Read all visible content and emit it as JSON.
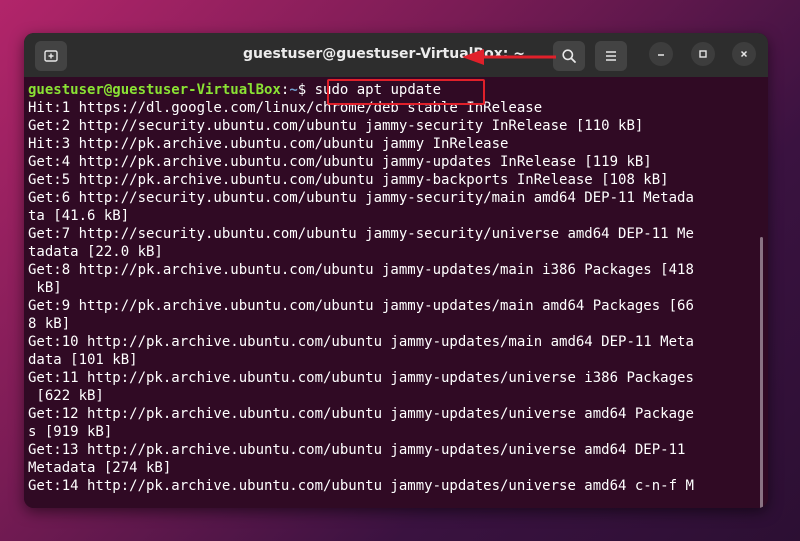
{
  "window": {
    "title": "guestuser@guestuser-VirtualBox: ~",
    "buttons": {
      "new_tab_icon": "new-tab-icon",
      "search_icon": "search-icon",
      "menu_icon": "hamburger-menu-icon",
      "minimize_icon": "minimize-icon",
      "maximize_icon": "maximize-icon",
      "close_icon": "close-icon"
    }
  },
  "prompt": {
    "user_host": "guestuser@guestuser-VirtualBox",
    "separator": ":",
    "directory": "~",
    "symbol": "$ ",
    "command": "sudo apt update"
  },
  "output": [
    "Hit:1 https://dl.google.com/linux/chrome/deb stable InRelease",
    "Get:2 http://security.ubuntu.com/ubuntu jammy-security InRelease [110 kB]",
    "Hit:3 http://pk.archive.ubuntu.com/ubuntu jammy InRelease",
    "Get:4 http://pk.archive.ubuntu.com/ubuntu jammy-updates InRelease [119 kB]",
    "Get:5 http://pk.archive.ubuntu.com/ubuntu jammy-backports InRelease [108 kB]",
    "Get:6 http://security.ubuntu.com/ubuntu jammy-security/main amd64 DEP-11 Metada",
    "ta [41.6 kB]",
    "Get:7 http://security.ubuntu.com/ubuntu jammy-security/universe amd64 DEP-11 Me",
    "tadata [22.0 kB]",
    "Get:8 http://pk.archive.ubuntu.com/ubuntu jammy-updates/main i386 Packages [418",
    " kB]",
    "Get:9 http://pk.archive.ubuntu.com/ubuntu jammy-updates/main amd64 Packages [66",
    "8 kB]",
    "Get:10 http://pk.archive.ubuntu.com/ubuntu jammy-updates/main amd64 DEP-11 Meta",
    "data [101 kB]",
    "Get:11 http://pk.archive.ubuntu.com/ubuntu jammy-updates/universe i386 Packages",
    " [622 kB]",
    "Get:12 http://pk.archive.ubuntu.com/ubuntu jammy-updates/universe amd64 Package",
    "s [919 kB]",
    "Get:13 http://pk.archive.ubuntu.com/ubuntu jammy-updates/universe amd64 DEP-11",
    "Metadata [274 kB]",
    "Get:14 http://pk.archive.ubuntu.com/ubuntu jammy-updates/universe amd64 c-n-f M"
  ],
  "colors": {
    "terminal_bg": "#300a24",
    "titlebar_bg": "#2d2d2d",
    "prompt_user": "#8ae234",
    "prompt_dir": "#729fcf",
    "highlight": "#e0202a"
  }
}
